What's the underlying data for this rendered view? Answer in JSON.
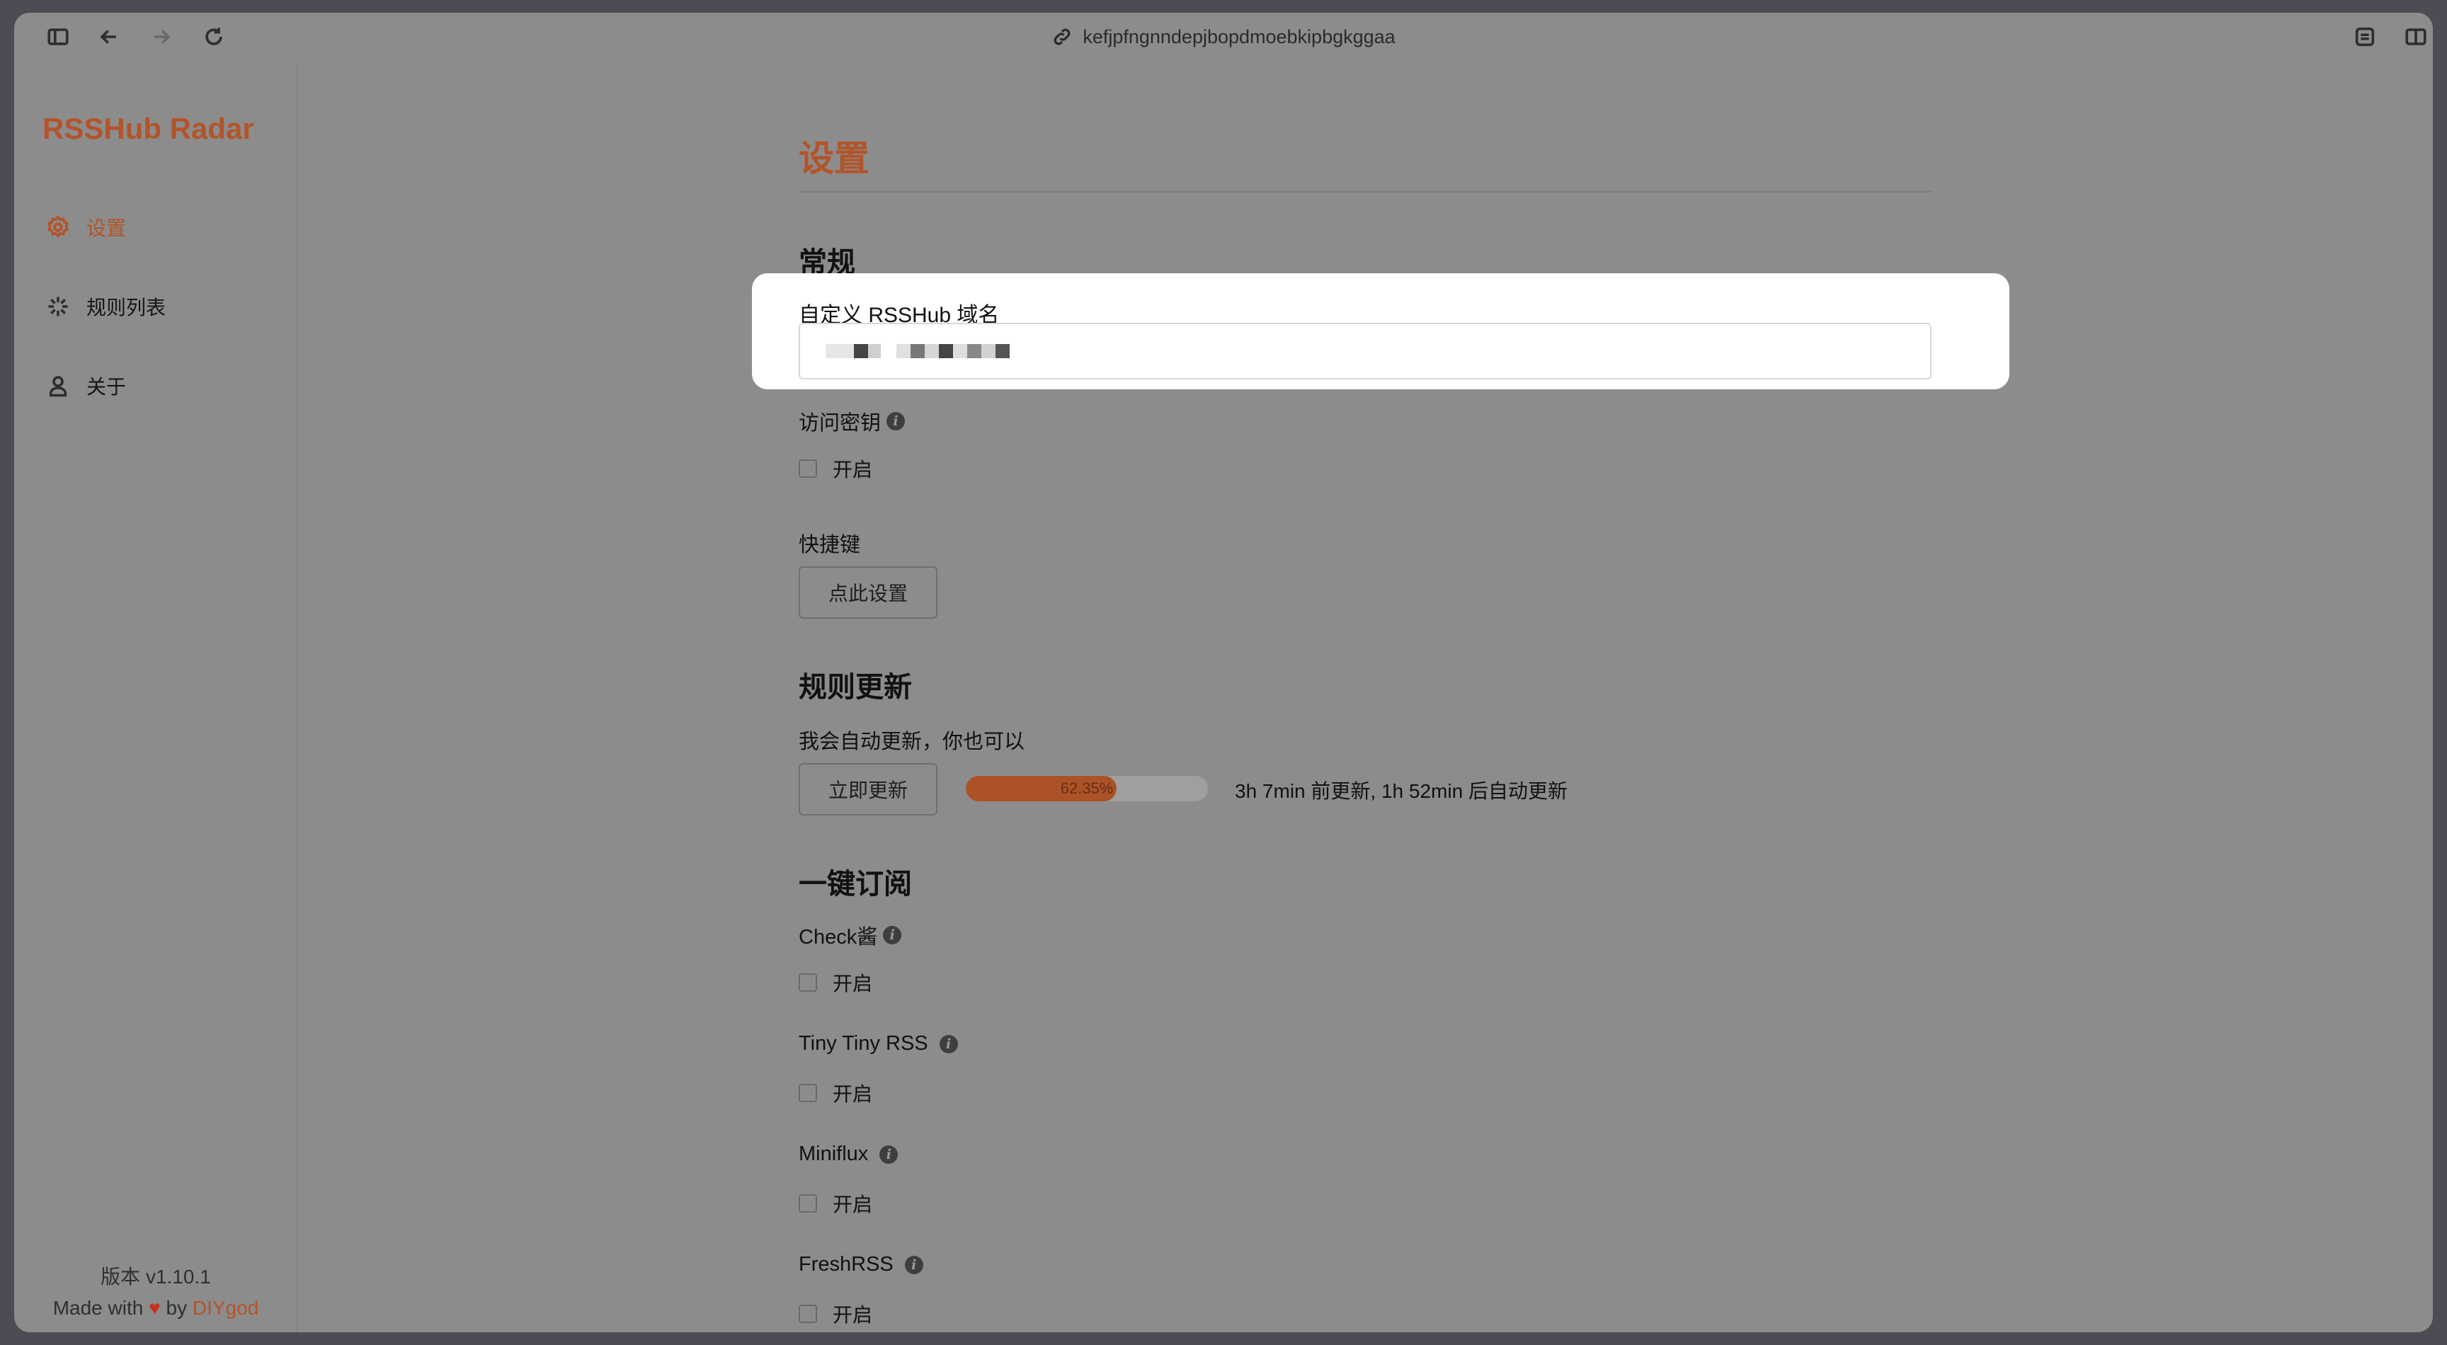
{
  "browser": {
    "url": "kefjpfngnndepjbopdmoebkipbgkggaa",
    "icons": [
      "sidebar-icon",
      "back-icon",
      "forward-icon",
      "reload-icon",
      "link-icon",
      "extension-icon",
      "split-view-icon"
    ]
  },
  "sidebar": {
    "brand": "RSSHub Radar",
    "items": [
      {
        "label": "设置",
        "icon": "gear-icon",
        "active": true
      },
      {
        "label": "规则列表",
        "icon": "rules-icon",
        "active": false
      },
      {
        "label": "关于",
        "icon": "user-icon",
        "active": false
      }
    ],
    "version": "版本 v1.10.1",
    "made_with": "Made with",
    "heart": "♥",
    "by": "by",
    "author": "DIYgod"
  },
  "main": {
    "title": "设置",
    "general": {
      "title": "常规",
      "domain_label": "自定义 RSSHub 域名",
      "access_key_label": "访问密钥",
      "access_key_toggle": "开启",
      "shortcut_label": "快捷键",
      "shortcut_button": "点此设置"
    },
    "rules_update": {
      "title": "规则更新",
      "description": "我会自动更新，你也可以",
      "update_button": "立即更新",
      "progress_percent": 62.35,
      "progress_text": "62.35%",
      "status": "3h 7min 前更新, 1h 52min 后自动更新"
    },
    "subscribe": {
      "title": "一键订阅",
      "items": [
        {
          "label": "Check酱",
          "toggle": "开启"
        },
        {
          "label": "Tiny Tiny RSS",
          "toggle": "开启"
        },
        {
          "label": "Miniflux",
          "toggle": "开启"
        },
        {
          "label": "FreshRSS",
          "toggle": "开启"
        }
      ]
    }
  },
  "colors": {
    "accent": "#b3542a",
    "overlay": "#8c8c8c",
    "highlight": "#ffffff"
  }
}
